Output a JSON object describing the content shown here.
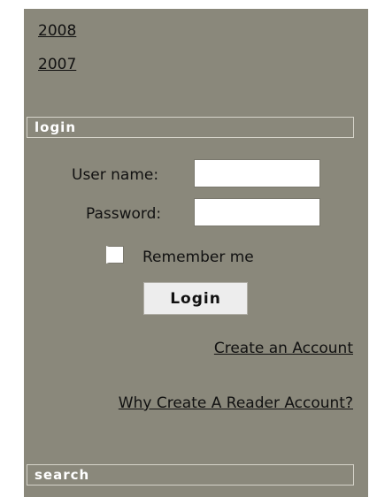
{
  "archive": {
    "links": [
      "2008",
      "2007"
    ]
  },
  "login": {
    "header": "login",
    "username_label": "User name:",
    "username_value": "",
    "password_label": "Password:",
    "password_value": "",
    "remember_label": "Remember me",
    "remember_checked": false,
    "login_button": "Login",
    "create_account": "Create an Account",
    "why_create": "Why Create A Reader Account?"
  },
  "search": {
    "header": "search"
  },
  "colors": {
    "panel_bg": "#8a887b",
    "header_border": "#d6d4ca",
    "text": "#111111"
  }
}
